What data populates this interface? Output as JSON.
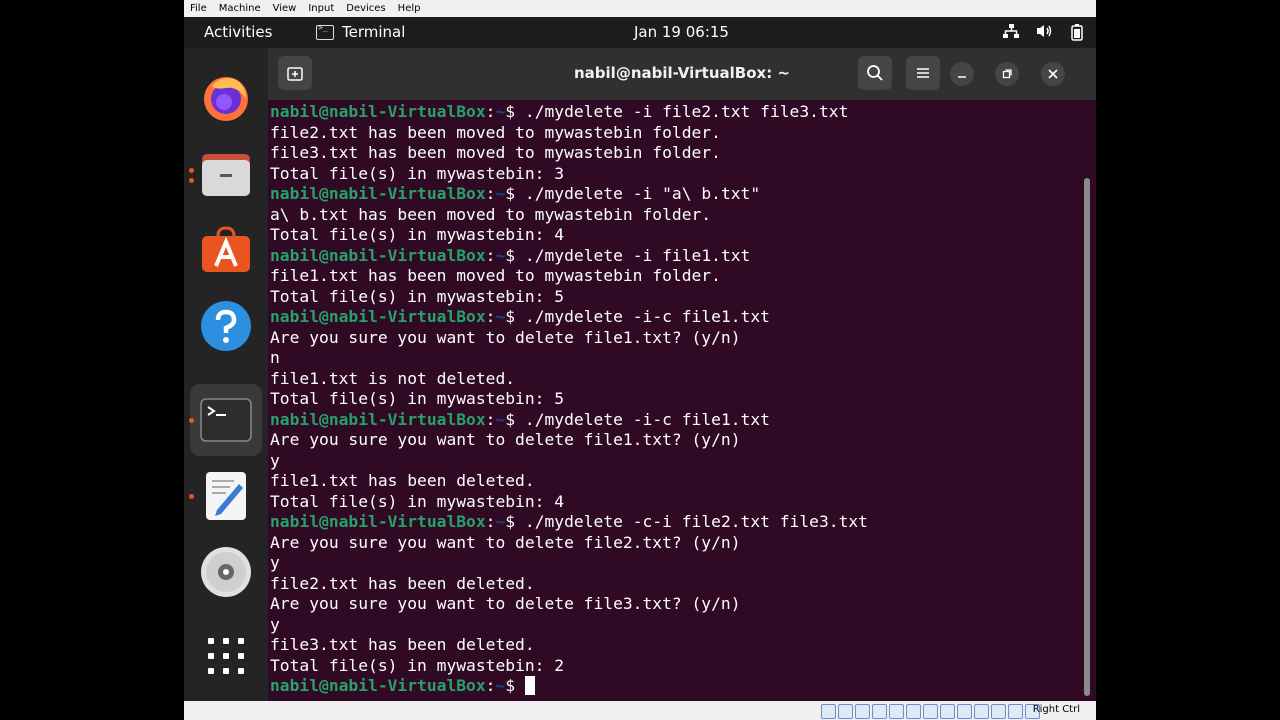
{
  "vbox_menu": [
    "File",
    "Machine",
    "View",
    "Input",
    "Devices",
    "Help"
  ],
  "topbar": {
    "activities": "Activities",
    "app_name": "Terminal",
    "clock": "Jan 19  06:15"
  },
  "dock": {
    "items": [
      "firefox-icon",
      "files-icon",
      "app-center-icon",
      "help-icon",
      "terminal-icon",
      "text-editor-icon",
      "disc-icon",
      "show-apps-icon"
    ]
  },
  "terminal": {
    "title": "nabil@nabil-VirtualBox: ~",
    "prompt_user": "nabil@nabil-VirtualBox",
    "prompt_path": "~",
    "lines": [
      {
        "type": "prompt",
        "cmd": " ./mydelete -i file2.txt file3.txt"
      },
      {
        "type": "out",
        "text": "file2.txt has been moved to mywastebin folder."
      },
      {
        "type": "out",
        "text": "file3.txt has been moved to mywastebin folder."
      },
      {
        "type": "out",
        "text": "Total file(s) in mywastebin: 3"
      },
      {
        "type": "prompt",
        "cmd": " ./mydelete -i \"a\\ b.txt\""
      },
      {
        "type": "out",
        "text": "a\\ b.txt has been moved to mywastebin folder."
      },
      {
        "type": "out",
        "text": "Total file(s) in mywastebin: 4"
      },
      {
        "type": "prompt",
        "cmd": " ./mydelete -i file1.txt"
      },
      {
        "type": "out",
        "text": "file1.txt has been moved to mywastebin folder."
      },
      {
        "type": "out",
        "text": "Total file(s) in mywastebin: 5"
      },
      {
        "type": "prompt",
        "cmd": " ./mydelete -i-c file1.txt"
      },
      {
        "type": "out",
        "text": "Are you sure you want to delete file1.txt? (y/n)"
      },
      {
        "type": "out",
        "text": "n"
      },
      {
        "type": "out",
        "text": "file1.txt is not deleted."
      },
      {
        "type": "out",
        "text": "Total file(s) in mywastebin: 5"
      },
      {
        "type": "prompt",
        "cmd": " ./mydelete -i-c file1.txt"
      },
      {
        "type": "out",
        "text": "Are you sure you want to delete file1.txt? (y/n)"
      },
      {
        "type": "out",
        "text": "y"
      },
      {
        "type": "out",
        "text": "file1.txt has been deleted."
      },
      {
        "type": "out",
        "text": "Total file(s) in mywastebin: 4"
      },
      {
        "type": "prompt",
        "cmd": " ./mydelete -c-i file2.txt file3.txt"
      },
      {
        "type": "out",
        "text": "Are you sure you want to delete file2.txt? (y/n)"
      },
      {
        "type": "out",
        "text": "y"
      },
      {
        "type": "out",
        "text": "file2.txt has been deleted."
      },
      {
        "type": "out",
        "text": "Are you sure you want to delete file3.txt? (y/n)"
      },
      {
        "type": "out",
        "text": "y"
      },
      {
        "type": "out",
        "text": "file3.txt has been deleted."
      },
      {
        "type": "out",
        "text": "Total file(s) in mywastebin: 2"
      },
      {
        "type": "prompt",
        "cmd": " ",
        "cursor": true
      }
    ]
  },
  "vbox_status": {
    "host_key": "Right Ctrl"
  },
  "colors": {
    "terminal_bg": "#300a24",
    "prompt_green": "#26a269",
    "prompt_blue": "#12488b",
    "accent_orange": "#e95420"
  }
}
